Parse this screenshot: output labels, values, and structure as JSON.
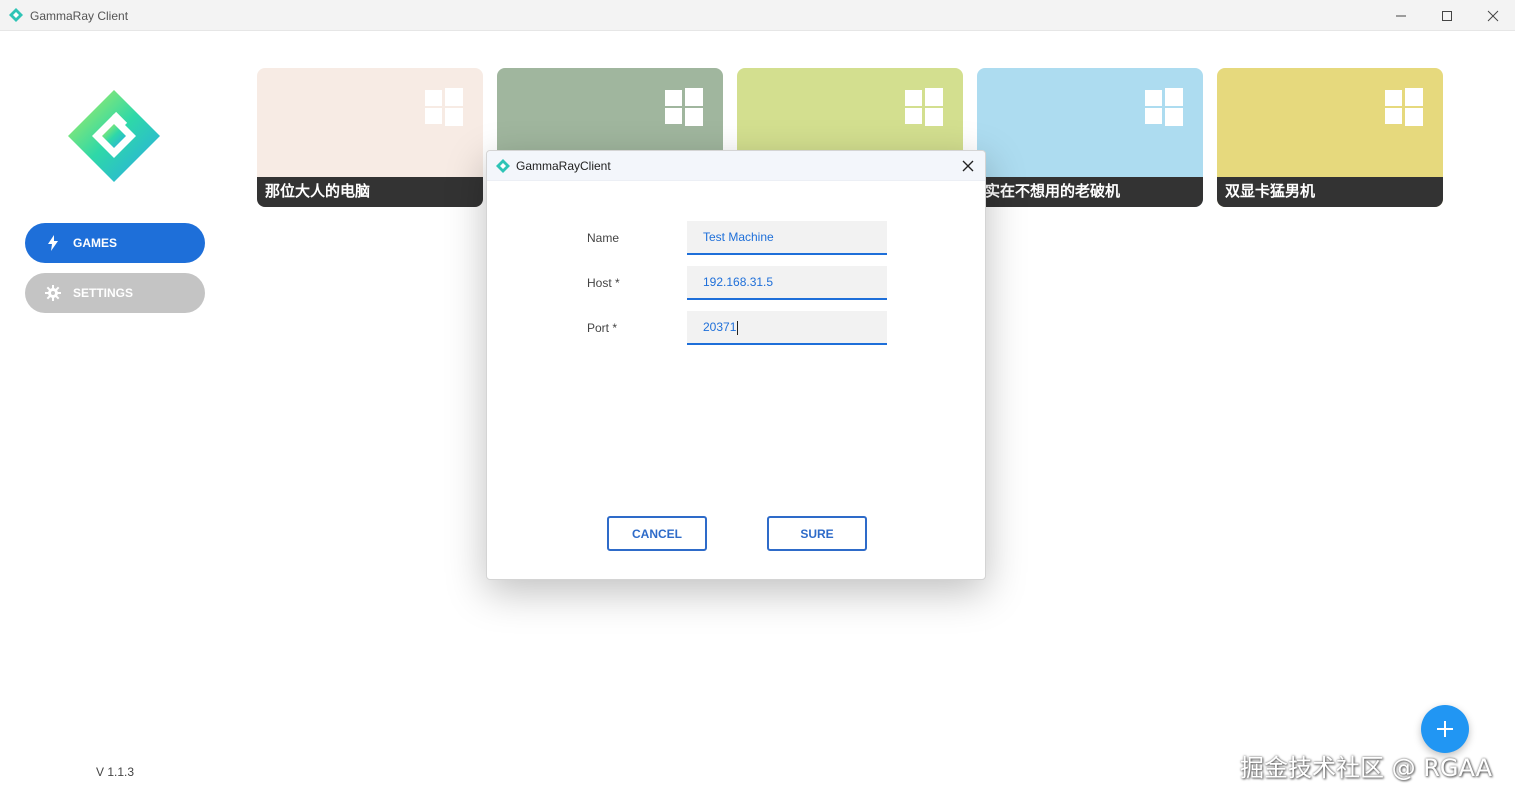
{
  "window": {
    "title": "GammaRay Client"
  },
  "sidebar": {
    "items": [
      {
        "label": "GAMES",
        "icon": "bolt-icon",
        "active": true
      },
      {
        "label": "SETTINGS",
        "icon": "gear-icon",
        "active": false
      }
    ],
    "version": "V 1.1.3"
  },
  "machines": [
    {
      "name": "那位大人的电脑",
      "bg": "#f7ebe4"
    },
    {
      "name": "",
      "bg": "#a0b69e"
    },
    {
      "name": "",
      "bg": "#d3df8f"
    },
    {
      "name": "实在不想用的老破机",
      "bg": "#addcf0"
    },
    {
      "name": "双显卡猛男机",
      "bg": "#e6d97d"
    }
  ],
  "dialog": {
    "title": "GammaRayClient",
    "fields": [
      {
        "label": "Name",
        "value": "Test Machine"
      },
      {
        "label": "Host *",
        "value": "192.168.31.5"
      },
      {
        "label": "Port *",
        "value": "20371"
      }
    ],
    "cancel_label": "CANCEL",
    "sure_label": "SURE"
  },
  "colors": {
    "accent": "#1e6fd9",
    "fab": "#2196f3"
  },
  "watermark": "掘金技术社区 @ RGAA"
}
